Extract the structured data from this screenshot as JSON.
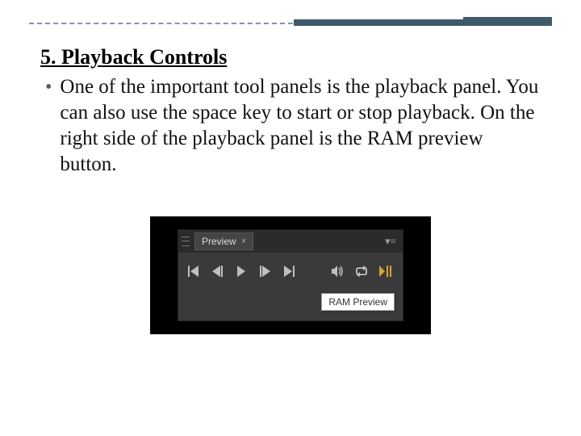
{
  "heading": "5. Playback Controls",
  "body": "One of the important tool panels is the playback panel. You can also use the space key to start or stop playback. On the right side of the playback panel is the RAM preview button.",
  "panel": {
    "tab_label": "Preview",
    "tooltip": "RAM Preview"
  }
}
